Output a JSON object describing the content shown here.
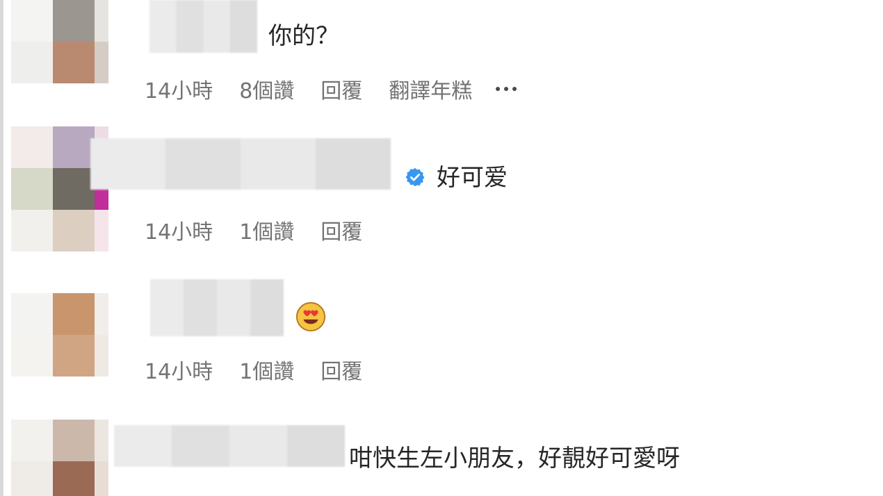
{
  "comments": [
    {
      "text": "你的？",
      "meta": {
        "time": "14小時",
        "likes": "8個讚",
        "reply": "回覆",
        "translate": "翻譯年糕",
        "more": "more-icon"
      }
    },
    {
      "text": "好可爱",
      "verified": true,
      "meta": {
        "time": "14小時",
        "likes": "1個讚",
        "reply": "回覆"
      }
    },
    {
      "emoji": "heart-eyes-emoji-icon",
      "meta": {
        "time": "14小時",
        "likes": "1個讚",
        "reply": "回覆"
      }
    },
    {
      "text": "咁快生左小朋友，好靚好可愛呀"
    }
  ],
  "colors": {
    "text": "#262626",
    "meta": "#737373",
    "verified": "#3897f0",
    "background": "#ffffff"
  }
}
